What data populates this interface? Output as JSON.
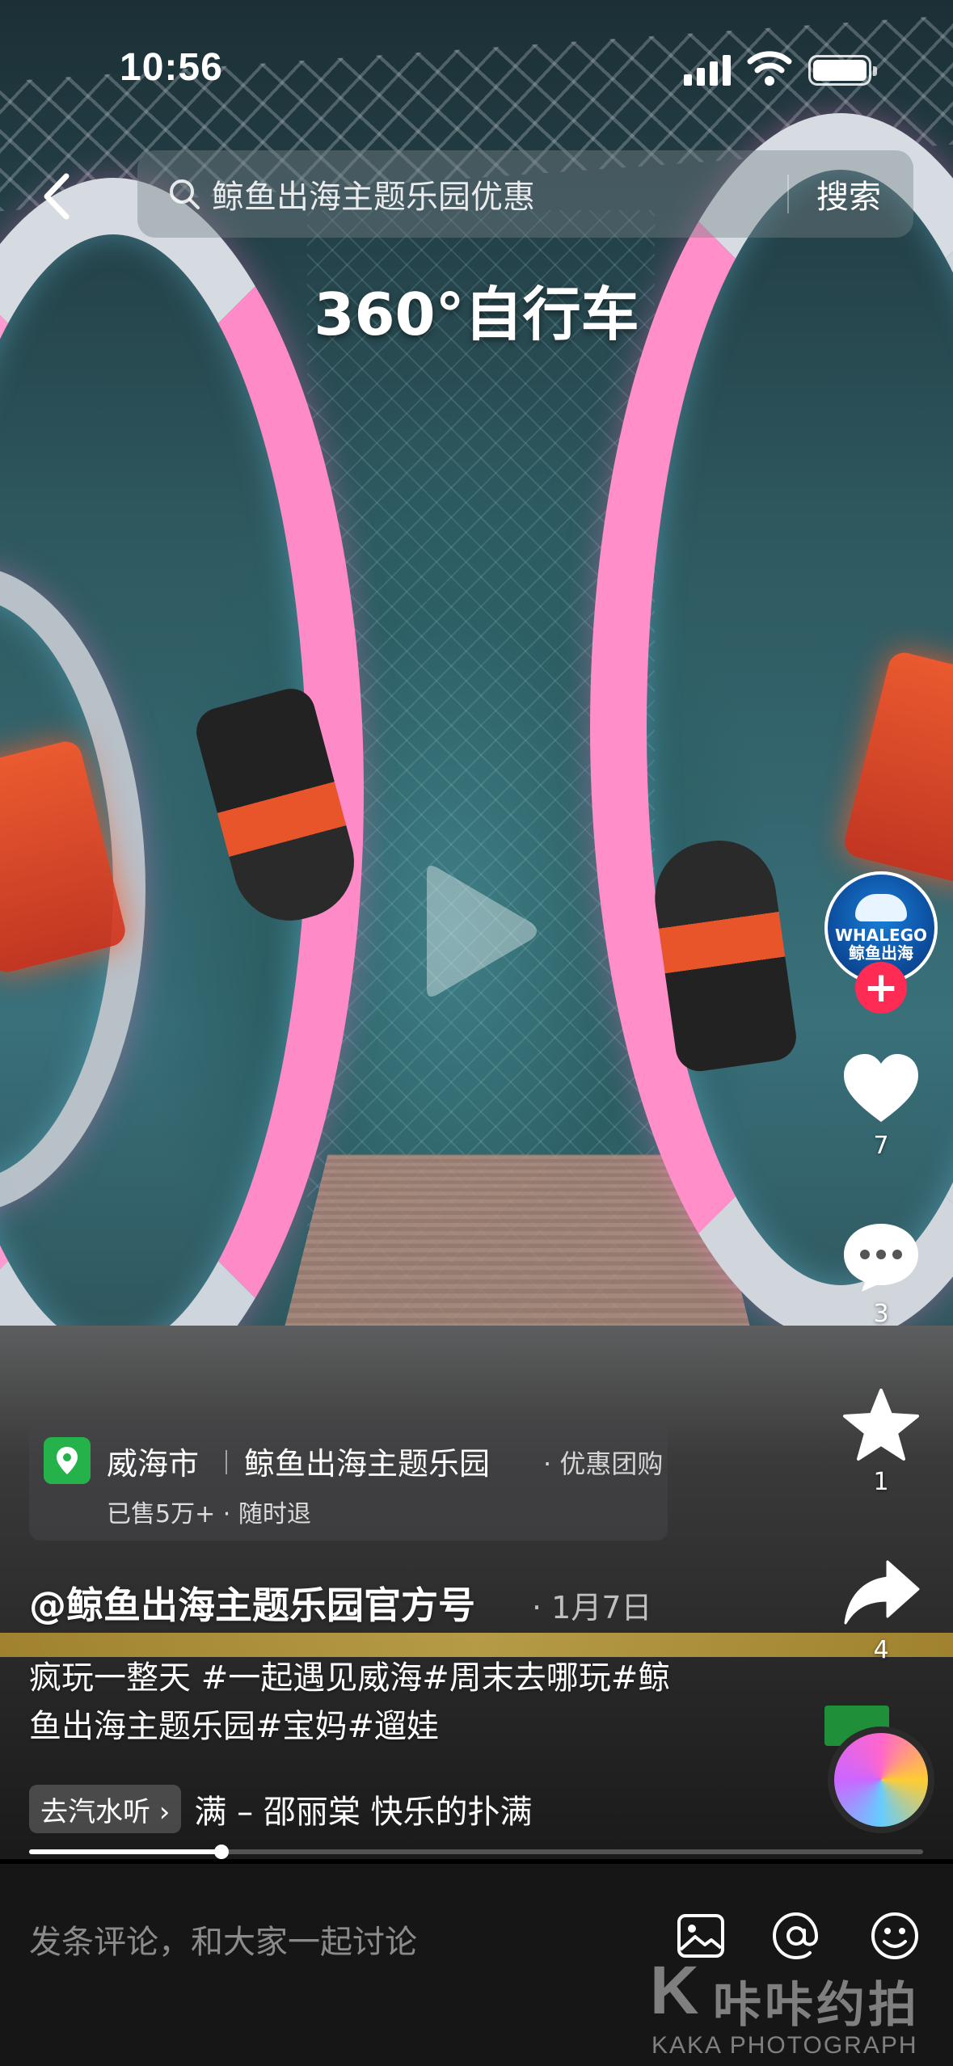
{
  "status_bar": {
    "time": "10:56"
  },
  "search": {
    "query": "鲸鱼出海主题乐园优惠",
    "button": "搜索"
  },
  "video": {
    "caption": "360°自行车",
    "progress": 0.215
  },
  "actions": {
    "avatar_text": "WHALEGO\n鲸鱼出海",
    "follow": "+",
    "like_count": "7",
    "comment_count": "3",
    "favorite_count": "1",
    "share_count": "4"
  },
  "poi": {
    "city": "威海市",
    "name": "鲸鱼出海主题乐园",
    "tag": "· 优惠团购",
    "sub": "已售5万+ · 随时退"
  },
  "post": {
    "author": "@鲸鱼出海主题乐园官方号",
    "date": "· 1月7日",
    "desc_line1": "疯玩一整天 #一起遇见威海#周末去哪玩#鲸",
    "desc_line2": "鱼出海主题乐园#宝妈#遛娃"
  },
  "music": {
    "chip": "去汽水听 ›",
    "text": "满 – 邵丽棠   快乐的扑满"
  },
  "comment_bar": {
    "placeholder": "发条评论，和大家一起讨论"
  },
  "watermark": {
    "letter": "K",
    "cn": "咔咔约拍",
    "en": "KAKA PHOTOGRAPH"
  },
  "icons": [
    "back-icon",
    "search-icon",
    "play-icon",
    "heart-icon",
    "comment-icon",
    "star-icon",
    "share-icon",
    "image-icon",
    "at-icon",
    "emoji-icon"
  ],
  "colors": {
    "accent": "#fe2c55",
    "poi_pin": "#25b24a",
    "comment_bar_bg": "#161616"
  }
}
